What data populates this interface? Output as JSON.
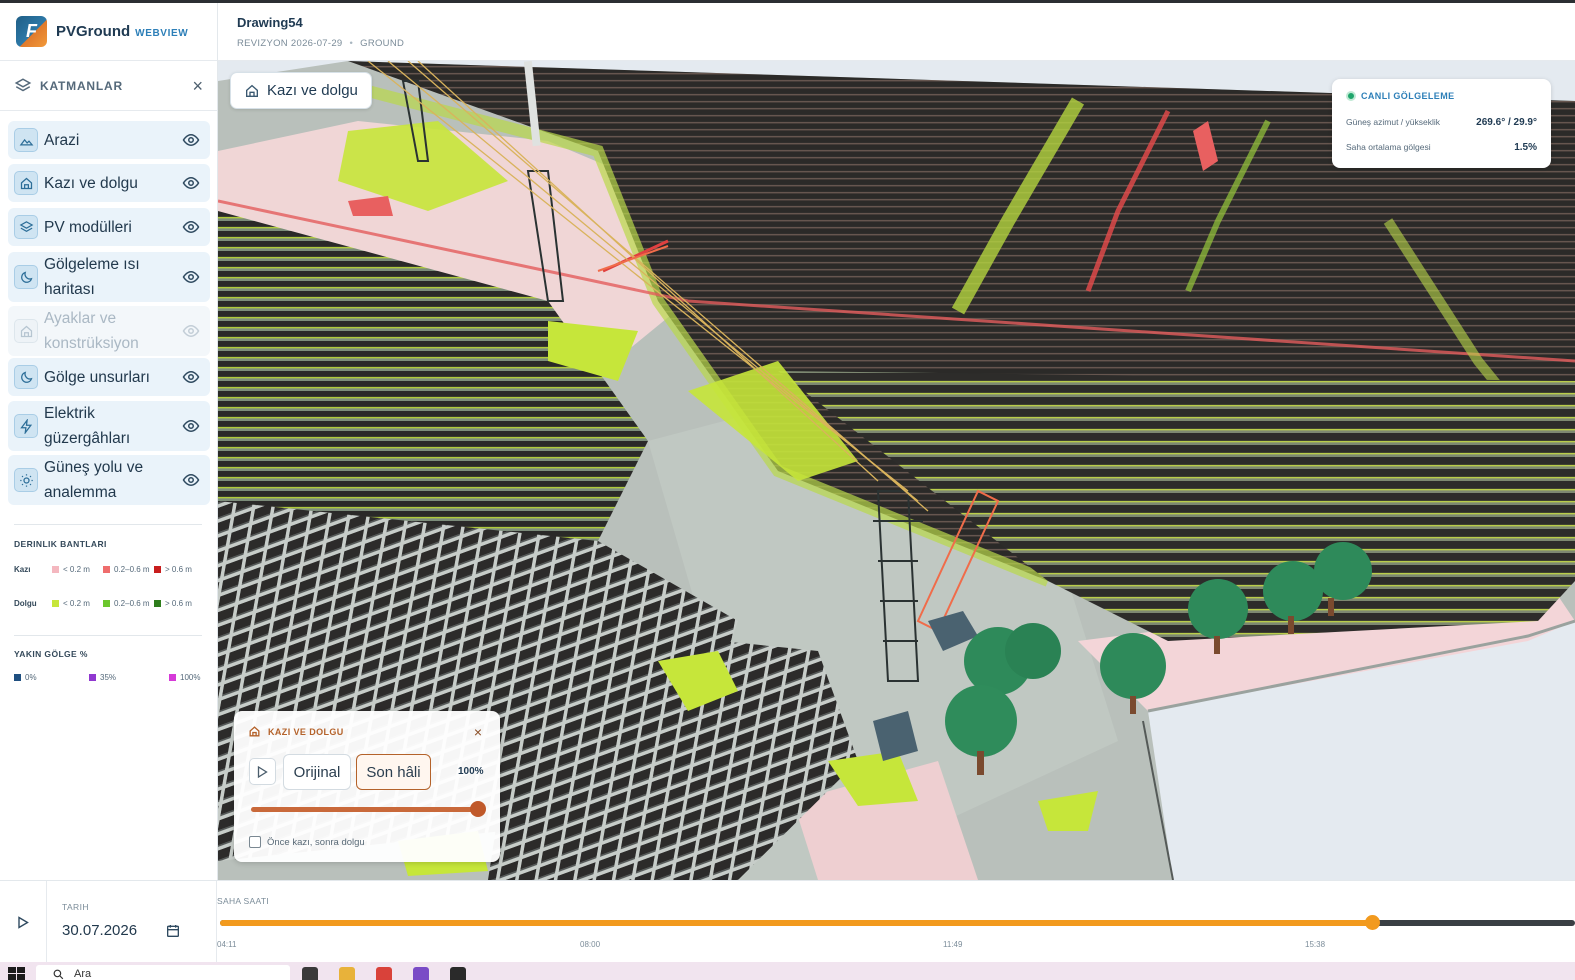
{
  "app": {
    "name": "PVGround",
    "suffix": "WEBVIEW",
    "logo_letter": "F"
  },
  "document": {
    "title": "Drawing54",
    "revision": "REVIZYON 2026-07-29",
    "mode": "GROUND"
  },
  "layers_panel": {
    "title": "KATMANLAR",
    "close": "×",
    "items": [
      {
        "label": "Arazi",
        "icon": "terrain-icon",
        "enabled": true
      },
      {
        "label": "Kazı ve dolgu",
        "icon": "home-icon",
        "enabled": true
      },
      {
        "label": "PV modülleri",
        "icon": "layers-icon",
        "enabled": true
      },
      {
        "label": "Gölgeleme ısı haritası",
        "icon": "moon-icon",
        "enabled": true
      },
      {
        "label": "Ayaklar ve konstrüksiyon",
        "icon": "home-icon",
        "enabled": false
      },
      {
        "label": "Gölge unsurları",
        "icon": "moon-icon",
        "enabled": true
      },
      {
        "label": "Elektrik güzergâhları",
        "icon": "bolt-icon",
        "enabled": true
      },
      {
        "label": "Güneş yolu ve analemma",
        "icon": "sun-icon",
        "enabled": true
      }
    ]
  },
  "depth_bands": {
    "title": "DERINLIK BANTLARI",
    "rows": [
      {
        "label": "Kazı",
        "items": [
          {
            "text": "< 0.2 m",
            "color": "#f4b7bf"
          },
          {
            "text": "0.2–0.6 m",
            "color": "#ef6d6d"
          },
          {
            "text": "> 0.6 m",
            "color": "#c81d1d"
          }
        ]
      },
      {
        "label": "Dolgu",
        "items": [
          {
            "text": "< 0.2 m",
            "color": "#c6e63a"
          },
          {
            "text": "0.2–0.6 m",
            "color": "#6cc72d"
          },
          {
            "text": "> 0.6 m",
            "color": "#2e7d1c"
          }
        ]
      }
    ]
  },
  "near_shade": {
    "title": "YAKIN GÖLGE %",
    "items": [
      {
        "text": "0%",
        "color": "#1f4f80"
      },
      {
        "text": "35%",
        "color": "#9038d0"
      },
      {
        "text": "100%",
        "color": "#d63ad8"
      }
    ]
  },
  "viewport": {
    "active_chip": "Kazı ve dolgu",
    "live_shading": {
      "title": "CANLI GÖLGELEME",
      "sun_label": "Güneş azimut / yükseklik",
      "sun_value": "269.6° / 29.9°",
      "avg_label": "Saha ortalama gölgesi",
      "avg_value": "1.5%"
    },
    "cut_fill": {
      "title": "KAZI VE DOLGU",
      "close": "×",
      "original": "Orijinal",
      "final": "Son hâli",
      "percent": "100%",
      "progress": 1.0,
      "checkbox": "Önce kazı, sonra dolgu",
      "checked": false
    }
  },
  "timeline": {
    "date_label": "TARIH",
    "date": "30.07.2026",
    "site_time_label": "SAHA SAATI",
    "ticks": [
      "04:11",
      "08:00",
      "11:49",
      "15:38"
    ],
    "progress": 0.85
  },
  "taskbar": {
    "search": "Ara"
  }
}
